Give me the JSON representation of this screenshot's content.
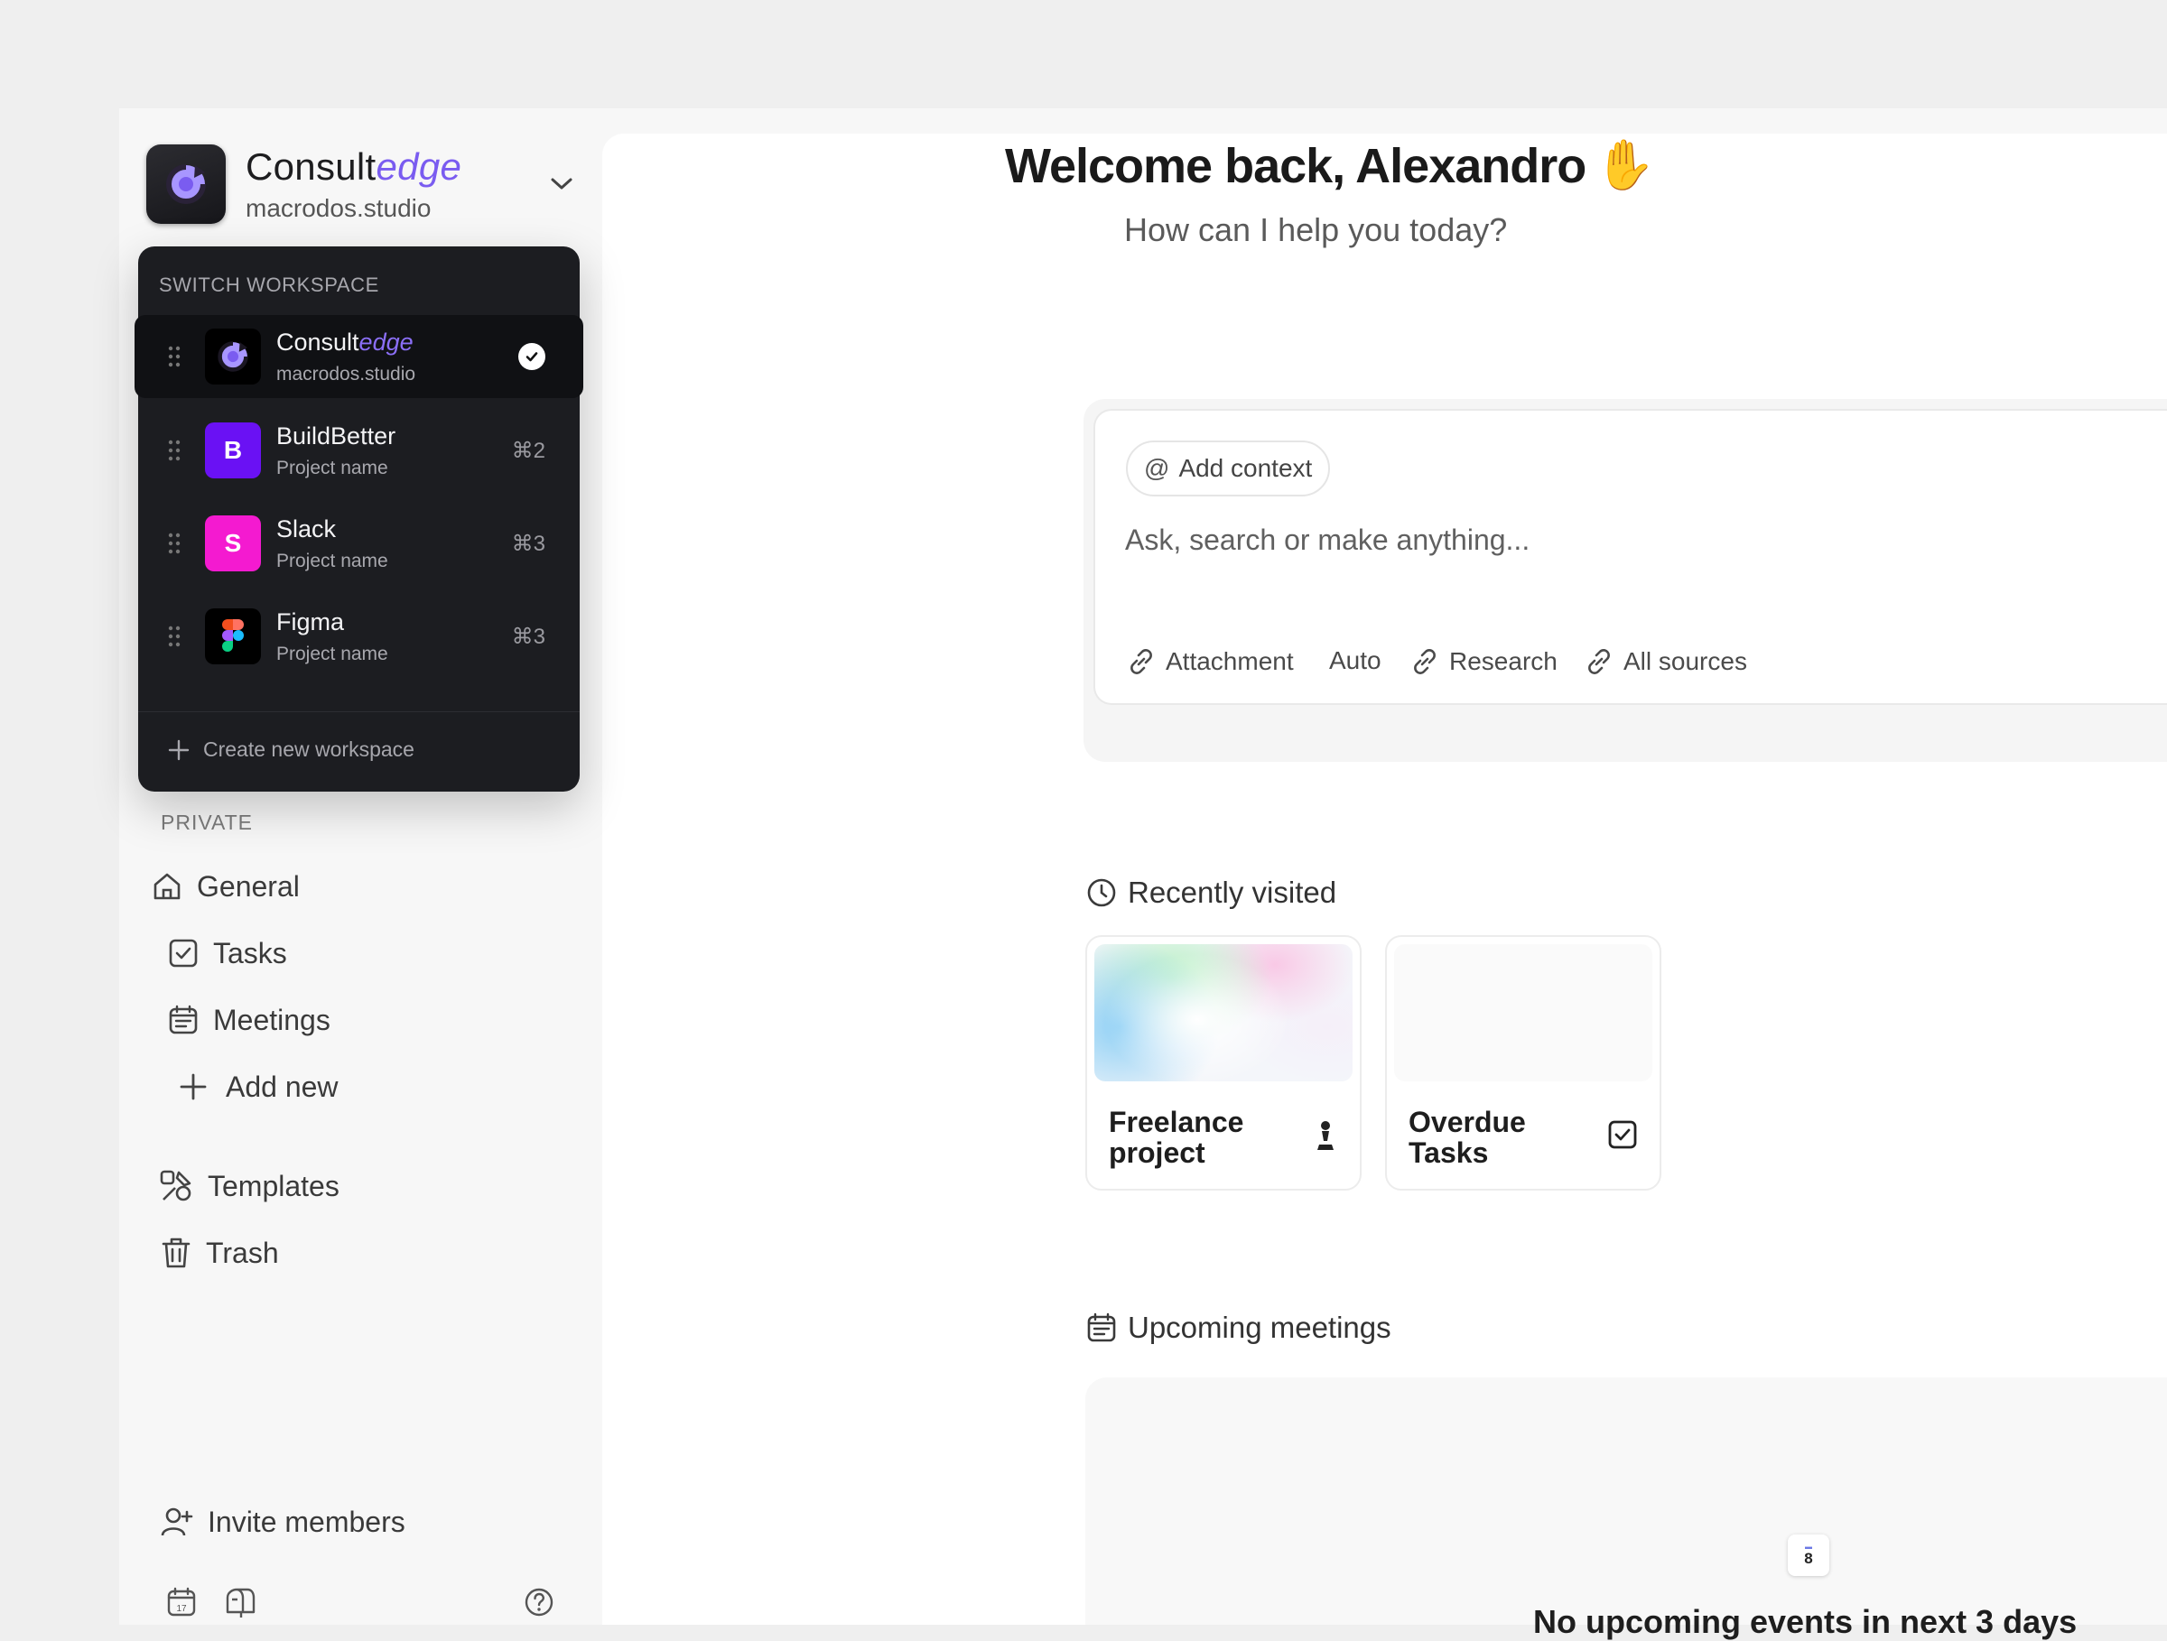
{
  "workspace": {
    "brand_main": "Consult",
    "brand_accent": "edge",
    "domain": "macrodos.studio"
  },
  "switcher": {
    "title": "SWITCH WORKSPACE",
    "items": [
      {
        "name_main": "Consult",
        "name_accent": "edge",
        "subtitle": "macrodos.studio",
        "active": true,
        "icon": "consultedge-logo"
      },
      {
        "name": "BuildBetter",
        "subtitle": "Project name",
        "shortcut": "⌘2",
        "avatar_letter": "B",
        "avatar_color": "#6a11f4"
      },
      {
        "name": "Slack",
        "subtitle": "Project name",
        "shortcut": "⌘3",
        "avatar_letter": "S",
        "avatar_color": "#f41ad0"
      },
      {
        "name": "Figma",
        "subtitle": "Project name",
        "shortcut": "⌘3",
        "icon": "figma-logo"
      }
    ],
    "create_label": "Create new workspace"
  },
  "sidebar": {
    "section_private": "PRIVATE",
    "items": [
      {
        "label": "General",
        "icon": "home-icon"
      },
      {
        "label": "Tasks",
        "icon": "checkbox-icon"
      },
      {
        "label": "Meetings",
        "icon": "calendar-icon"
      },
      {
        "label": "Add new",
        "icon": "plus-icon"
      },
      {
        "label": "Templates",
        "icon": "templates-icon"
      },
      {
        "label": "Trash",
        "icon": "trash-icon"
      }
    ],
    "invite_label": "Invite members",
    "bottom_icons": [
      "calendar-17-icon",
      "mailbox-icon",
      "help-icon"
    ]
  },
  "main": {
    "greeting": "Welcome back, Alexandro",
    "greeting_emoji": "✋",
    "subtitle": "How can I help you today?",
    "prompt": {
      "context_chip": "Add context",
      "placeholder": "Ask, search or make anything...",
      "tools": [
        "Attachment",
        "Auto",
        "Research",
        "All sources"
      ]
    },
    "recently_visited": {
      "title": "Recently visited",
      "cards": [
        {
          "title": "Freelance project",
          "icon": "chess-pawn-icon"
        },
        {
          "title": "Overdue Tasks",
          "icon": "checkbox-icon"
        }
      ]
    },
    "upcoming_meetings": {
      "title": "Upcoming meetings",
      "calendar_day": "8",
      "empty_text": "No upcoming events in next 3 days"
    }
  },
  "colors": {
    "accent": "#7a5cf0",
    "dropdown_bg": "#1c1d21",
    "page_bg": "#efefef"
  }
}
